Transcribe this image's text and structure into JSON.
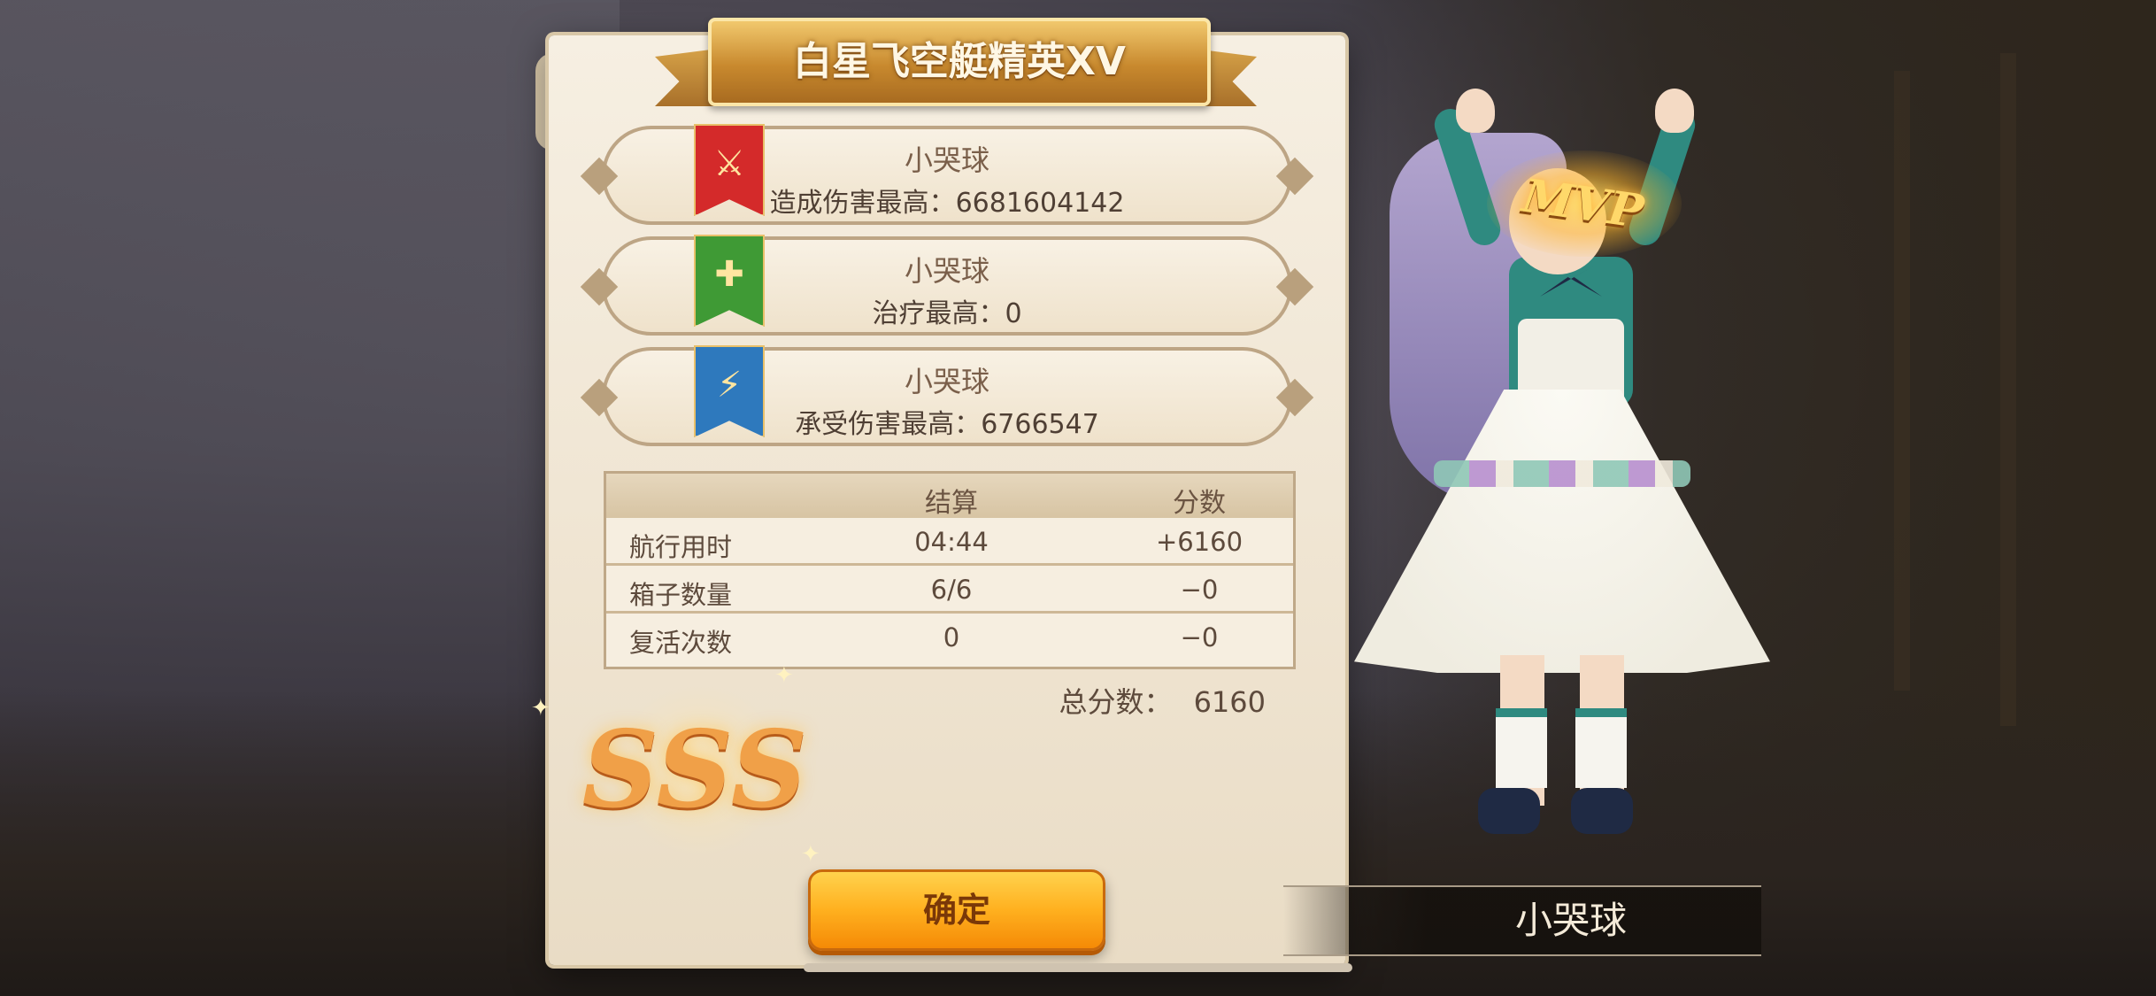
{
  "title": "白星飞空艇精英XV",
  "stats": [
    {
      "name": "小哭球",
      "label": "造成伤害最高：",
      "value": "6681604142",
      "color": "#d42a2a",
      "icon": "crossed-swords-icon"
    },
    {
      "name": "小哭球",
      "label": "治疗最高：",
      "value": "0",
      "color": "#3f9a35",
      "icon": "shield-cross-icon"
    },
    {
      "name": "小哭球",
      "label": "承受伤害最高：",
      "value": "6766547",
      "color": "#2e79bd",
      "icon": "shield-lightning-icon"
    }
  ],
  "table": {
    "headers": [
      "结算",
      "分数"
    ],
    "rows": [
      {
        "label": "航行用时",
        "result": "04:44",
        "score": "+6160"
      },
      {
        "label": "箱子数量",
        "result": "6/6",
        "score": "−0"
      },
      {
        "label": "复活次数",
        "result": "0",
        "score": "−0"
      }
    ]
  },
  "total": {
    "label": "总分数：",
    "value": "6160"
  },
  "grade": "SSS",
  "confirm_label": "确定",
  "mvp": {
    "badge": "MVP",
    "player_name": "小哭球"
  }
}
